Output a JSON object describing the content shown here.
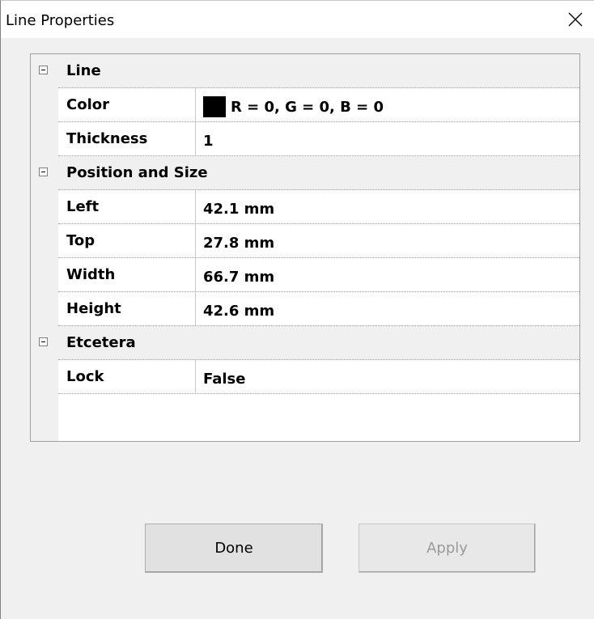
{
  "window": {
    "title": "Line Properties",
    "close_icon": "close-icon"
  },
  "property_grid": {
    "categories": [
      {
        "label": "Line",
        "properties": [
          {
            "name": "Color",
            "value": "R = 0, G = 0, B = 0",
            "swatch_color": "#000000"
          },
          {
            "name": "Thickness",
            "value": "1"
          }
        ]
      },
      {
        "label": "Position and Size",
        "properties": [
          {
            "name": "Left",
            "value": "42.1 mm"
          },
          {
            "name": "Top",
            "value": "27.8 mm"
          },
          {
            "name": "Width",
            "value": "66.7 mm"
          },
          {
            "name": "Height",
            "value": "42.6 mm"
          }
        ]
      },
      {
        "label": "Etcetera",
        "properties": [
          {
            "name": "Lock",
            "value": "False"
          }
        ]
      }
    ]
  },
  "buttons": {
    "done_label": "Done",
    "apply_label": "Apply",
    "apply_enabled": false
  }
}
